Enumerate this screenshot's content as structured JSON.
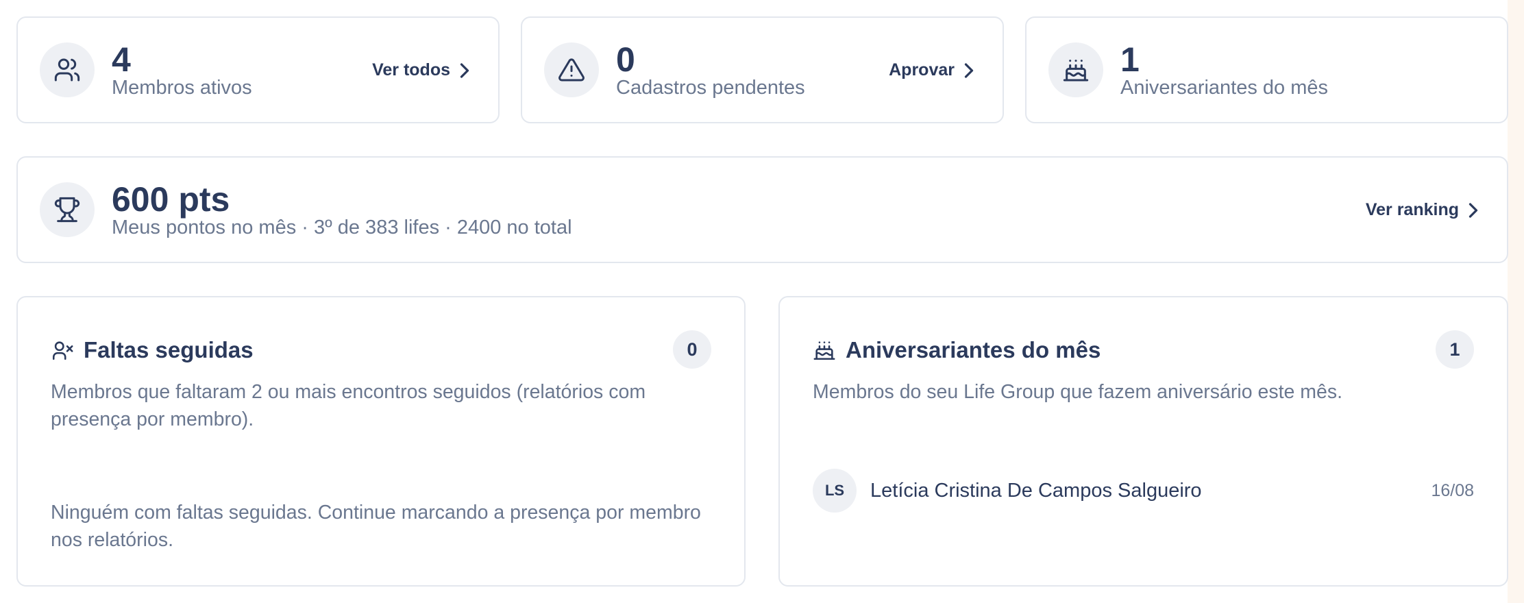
{
  "stats": [
    {
      "icon": "users-icon",
      "value": "4",
      "label": "Membros ativos",
      "link": "Ver todos"
    },
    {
      "icon": "alert-triangle-icon",
      "value": "0",
      "label": "Cadastros pendentes",
      "link": "Aprovar"
    },
    {
      "icon": "cake-icon",
      "value": "1",
      "label": "Aniversariantes do mês"
    }
  ],
  "points": {
    "icon": "trophy-icon",
    "value": "600 pts",
    "label": "Meus pontos no mês · 3º de 383 lifes · 2400 no total",
    "link": "Ver ranking"
  },
  "absences": {
    "icon": "user-x-icon",
    "title": "Faltas seguidas",
    "count": "0",
    "description": "Membros que faltaram 2 ou mais encontros seguidos (relatórios com presença por membro).",
    "empty_message": "Ninguém com faltas seguidas. Continue marcando a presença por membro nos relatórios."
  },
  "birthdays": {
    "icon": "cake-icon",
    "title": "Aniversariantes do mês",
    "count": "1",
    "description": "Membros do seu Life Group que fazem aniversário este mês.",
    "people": [
      {
        "initials": "LS",
        "name": "Letícia Cristina De Campos Salgueiro",
        "date": "16/08"
      }
    ]
  },
  "colors": {
    "text": "#2b3a5c",
    "muted": "#6a778f",
    "border": "#e3e7ee",
    "chip": "#eef0f4"
  }
}
